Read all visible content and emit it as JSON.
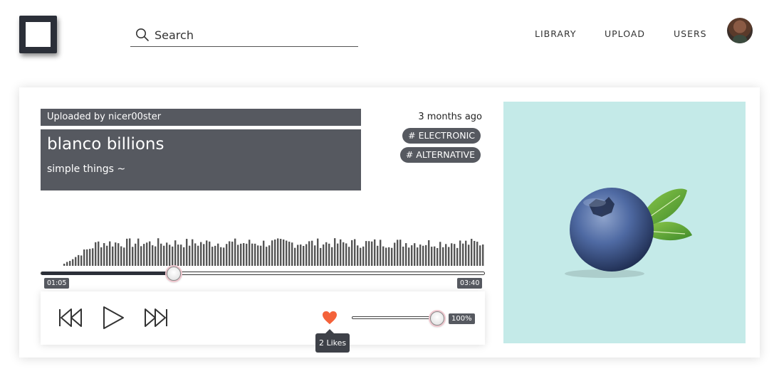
{
  "header": {
    "search_placeholder": "Search",
    "nav": [
      "LIBRARY",
      "UPLOAD",
      "USERS"
    ]
  },
  "track": {
    "uploaded_by": "Uploaded by nicer00ster",
    "title": "blanco billions",
    "subtitle": "simple things ~",
    "time_ago": "3 months ago",
    "tags": [
      "# ELECTRONIC",
      "# ALTERNATIVE"
    ]
  },
  "player": {
    "current_time": "01:05",
    "duration": "03:40",
    "progress_fraction": 0.3,
    "volume": "100%",
    "volume_fraction": 1.0,
    "likes": "2 Likes"
  },
  "colors": {
    "dark": "#565960",
    "heart": "#f4623a",
    "art_bg": "#c4eae8"
  }
}
